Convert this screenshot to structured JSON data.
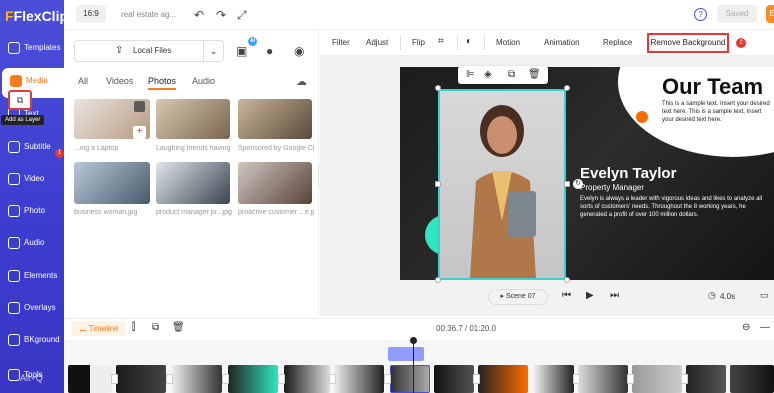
{
  "brand": {
    "name": "FlexClip"
  },
  "sidebar": {
    "items": [
      {
        "label": "Templates",
        "icon": "templates-icon"
      },
      {
        "label": "Media",
        "icon": "media-icon",
        "active": true
      },
      {
        "label": "Text",
        "icon": "text-icon"
      },
      {
        "label": "Subtitle",
        "icon": "subtitle-icon"
      },
      {
        "label": "Video",
        "icon": "video-icon"
      },
      {
        "label": "Photo",
        "icon": "photo-icon"
      },
      {
        "label": "Audio",
        "icon": "audio-icon"
      },
      {
        "label": "Elements",
        "icon": "elements-icon"
      },
      {
        "label": "Overlays",
        "icon": "overlays-icon"
      },
      {
        "label": "BKground",
        "icon": "background-icon"
      },
      {
        "label": "Tools",
        "icon": "tools-icon"
      }
    ]
  },
  "topbar": {
    "ratio": "16:9",
    "project_name": "real estate ag...",
    "saved_label": "Saved",
    "export_label": "E",
    "help": "?"
  },
  "media_panel": {
    "local_files_label": "Local Files",
    "ai_badge": "AI",
    "tabs": [
      "All",
      "Videos",
      "Photos",
      "Audio"
    ],
    "selected_tab": "Photos",
    "add_layer_tooltip": "Add as Layer",
    "step1": "1",
    "captions": [
      "...ing a Laptop",
      "Laughing friends having ...",
      "Sponsored by Google Ch...",
      "business woman.jpg",
      "product manager pr...jpg",
      "proactive customer ...e.jpg"
    ]
  },
  "edit_toolbar": {
    "items": [
      "Filter",
      "Adjust",
      "Flip",
      "Motion",
      "Animation",
      "Replace"
    ],
    "remove_bg": "Remove Background",
    "step2": "2"
  },
  "canvas": {
    "heading": "Our Team",
    "sample": "This is a sample text. Insert your desired text here. This is a sample text, Insert your desired text here.",
    "name": "Evelyn Taylor",
    "role": "Property Manager",
    "description": "Evelyn is always a leader with vigorous ideas and likes to analyze all sorts of customers' needs. Throughout the 8 working years, he generated a profit of over 100 million dollars."
  },
  "player": {
    "scene": "Scene 07",
    "duration": "4.0s"
  },
  "timeline": {
    "label": "Timeline",
    "timecode": "00:36.7 / 01:20.0",
    "alt_hint": "Alt+Q"
  },
  "colors": {
    "brand": "#4a4fd8",
    "accent": "#ff7a1a",
    "highlight": "#e53935",
    "teal": "#2ee6c0"
  }
}
